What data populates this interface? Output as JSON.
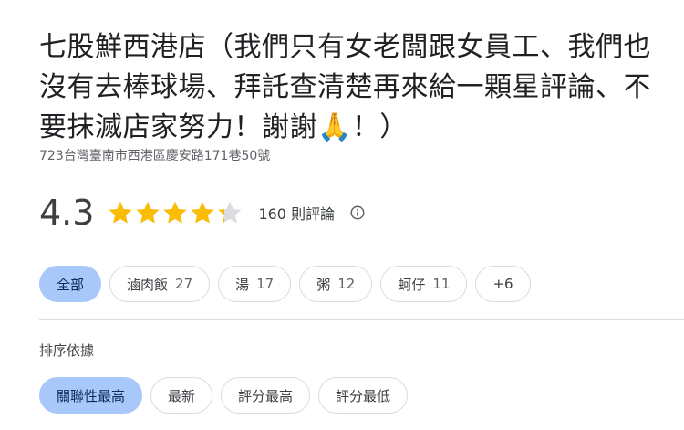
{
  "place": {
    "title": "七股鮮西港店（我們只有女老闆跟女員工、我們也沒有去棒球場、拜託查清楚再來給一顆星評論、不要抹滅店家努力！謝謝🙏！）",
    "address": "723台灣臺南市西港區慶安路171巷50號"
  },
  "rating": {
    "score": "4.3",
    "stars_value": 4.3,
    "stars_max": 5,
    "review_count": "160 則評論",
    "info_icon": "info-icon",
    "star_color": "#fbbc04"
  },
  "topic_chips": [
    {
      "label": "全部",
      "count": "",
      "selected": true
    },
    {
      "label": "滷肉飯",
      "count": "27",
      "selected": false
    },
    {
      "label": "湯",
      "count": "17",
      "selected": false
    },
    {
      "label": "粥",
      "count": "12",
      "selected": false
    },
    {
      "label": "蚵仔",
      "count": "11",
      "selected": false
    },
    {
      "label": "+6",
      "count": "",
      "selected": false
    }
  ],
  "sort": {
    "label": "排序依據",
    "options": [
      {
        "label": "關聯性最高",
        "selected": true
      },
      {
        "label": "最新",
        "selected": false
      },
      {
        "label": "評分最高",
        "selected": false
      },
      {
        "label": "評分最低",
        "selected": false
      }
    ]
  },
  "colors": {
    "selected_chip_bg": "#a8c7fa",
    "chip_border": "#dadce0"
  }
}
